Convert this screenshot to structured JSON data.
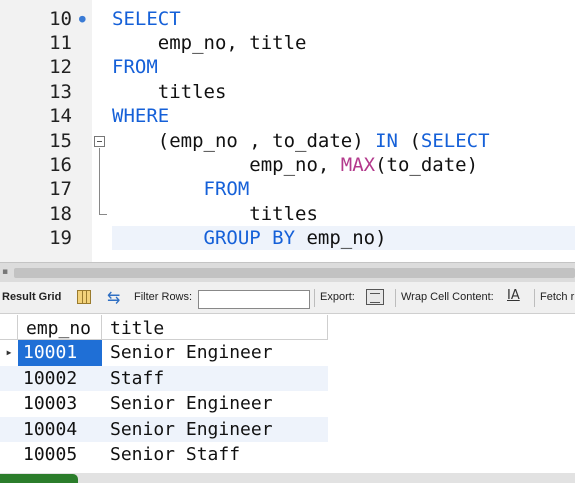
{
  "editor": {
    "lines": [
      {
        "number": "10",
        "code": [
          {
            "t": "SELECT",
            "s": "kw"
          }
        ]
      },
      {
        "number": "11",
        "code": [
          {
            "t": "    emp_no, title",
            "s": ""
          }
        ]
      },
      {
        "number": "12",
        "code": [
          {
            "t": "FROM",
            "s": "kw"
          }
        ]
      },
      {
        "number": "13",
        "code": [
          {
            "t": "    titles",
            "s": ""
          }
        ]
      },
      {
        "number": "14",
        "code": [
          {
            "t": "WHERE",
            "s": "kw"
          }
        ]
      },
      {
        "number": "15",
        "code": [
          {
            "t": "    (emp_no , to_date) ",
            "s": ""
          },
          {
            "t": "IN",
            "s": "kw"
          },
          {
            "t": " (",
            "s": ""
          },
          {
            "t": "SELECT",
            "s": "kw"
          }
        ]
      },
      {
        "number": "16",
        "code": [
          {
            "t": "            emp_no, ",
            "s": ""
          },
          {
            "t": "MAX",
            "s": "fn"
          },
          {
            "t": "(to_date)",
            "s": ""
          }
        ]
      },
      {
        "number": "17",
        "code": [
          {
            "t": "        ",
            "s": ""
          },
          {
            "t": "FROM",
            "s": "kw"
          }
        ]
      },
      {
        "number": "18",
        "code": [
          {
            "t": "            titles",
            "s": ""
          }
        ]
      },
      {
        "number": "19",
        "code": [
          {
            "t": "        ",
            "s": ""
          },
          {
            "t": "GROUP BY",
            "s": "kw"
          },
          {
            "t": " emp_no)",
            "s": ""
          }
        ]
      }
    ],
    "current_line": "19",
    "colors": {
      "keyword": "#1560d8",
      "function": "#b3398c",
      "current_line_bg": "#eef3fb"
    }
  },
  "toolbar": {
    "result_grid_label": "Result Grid",
    "filter_label": "Filter Rows:",
    "filter_value": "",
    "export_label": "Export:",
    "wrap_label": "Wrap Cell Content:",
    "wrap_icon": "IA",
    "fetch_label": "Fetch r",
    "icons": [
      "grid-icon",
      "refresh-icon",
      "export-icon",
      "wrap-cell-icon"
    ]
  },
  "results": {
    "columns": [
      "emp_no",
      "title"
    ],
    "rows": [
      {
        "emp_no": "10001",
        "title": "Senior Engineer",
        "selected": true
      },
      {
        "emp_no": "10002",
        "title": "Staff",
        "selected": false
      },
      {
        "emp_no": "10003",
        "title": "Senior Engineer",
        "selected": false
      },
      {
        "emp_no": "10004",
        "title": "Senior Engineer",
        "selected": false
      },
      {
        "emp_no": "10005",
        "title": "Senior Staff",
        "selected": false
      }
    ],
    "selection_color": "#1f6fd6"
  }
}
